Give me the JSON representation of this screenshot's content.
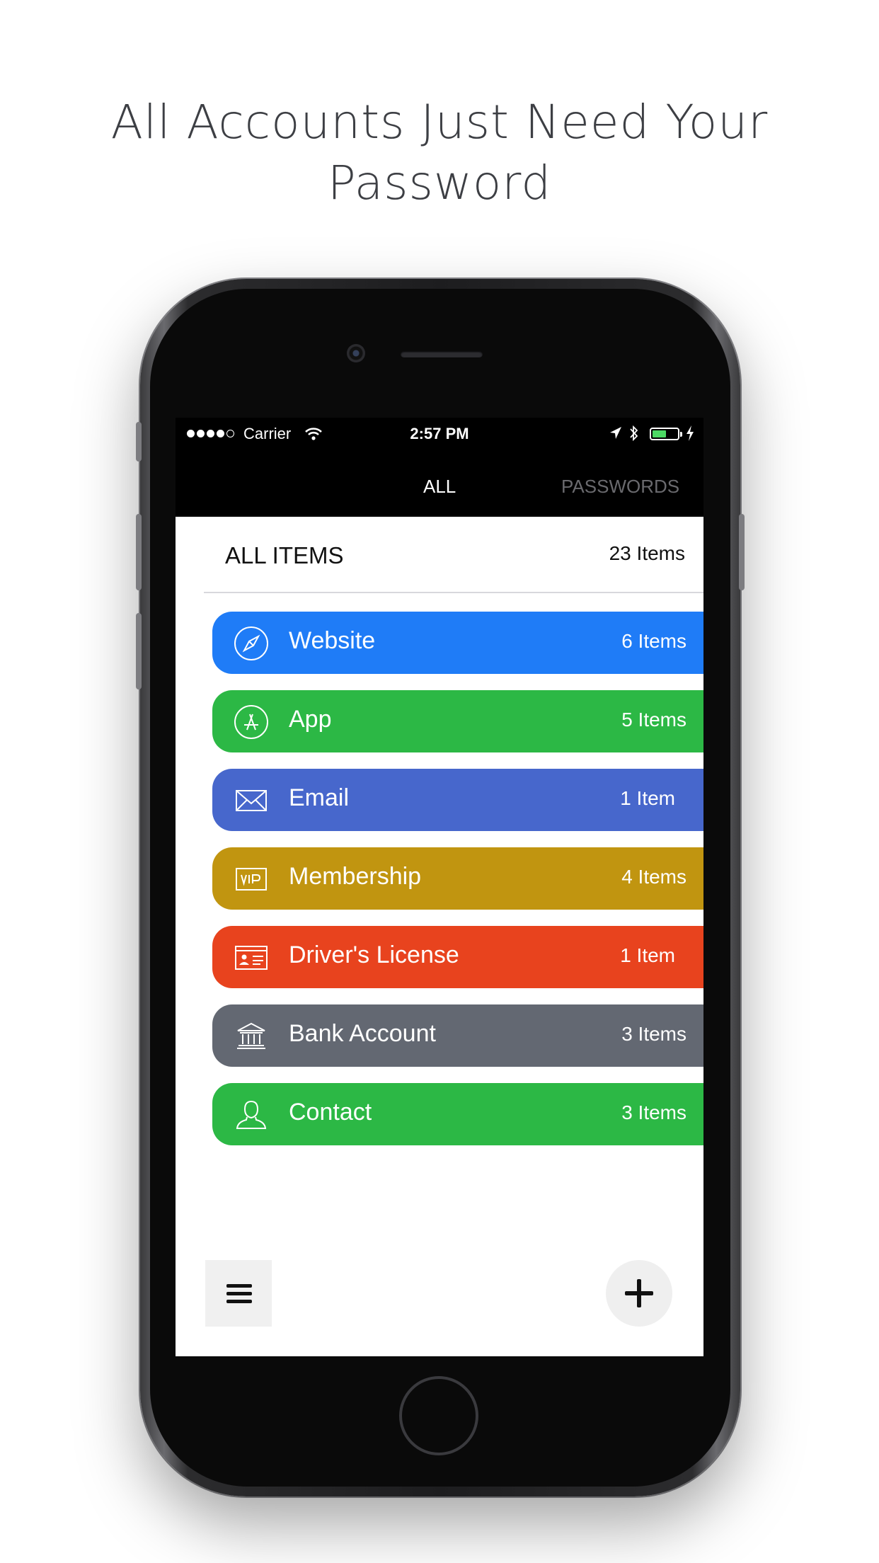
{
  "headline": {
    "line1": "All Accounts Just Need Your",
    "line2": "Password"
  },
  "status_bar": {
    "carrier": "Carrier",
    "time": "2:57 PM",
    "battery_level": 0.55
  },
  "tabs": [
    {
      "label": "ALL",
      "active": true
    },
    {
      "label": "PASSWORDS",
      "active": false
    }
  ],
  "summary": {
    "title": "ALL ITEMS",
    "count": "23 Items"
  },
  "categories": [
    {
      "label": "Website",
      "count": "6 Items",
      "color": "#1f7cf7",
      "icon": "compass-icon"
    },
    {
      "label": "App",
      "count": "5 Items",
      "color": "#2cb845",
      "icon": "app-store-icon"
    },
    {
      "label": "Email",
      "count": "1 Item",
      "color": "#4767cc",
      "icon": "envelope-icon"
    },
    {
      "label": "Membership",
      "count": "4 Items",
      "color": "#c19510",
      "icon": "vip-card-icon"
    },
    {
      "label": "Driver's License",
      "count": "1 Item",
      "color": "#e8431e",
      "icon": "id-card-icon"
    },
    {
      "label": "Bank Account",
      "count": "3 Items",
      "color": "#636872",
      "icon": "bank-icon"
    },
    {
      "label": "Contact",
      "count": "3 Items",
      "color": "#2cb845",
      "icon": "person-icon"
    }
  ],
  "controls": {
    "menu_icon": "hamburger-icon",
    "add_icon": "plus-icon"
  }
}
